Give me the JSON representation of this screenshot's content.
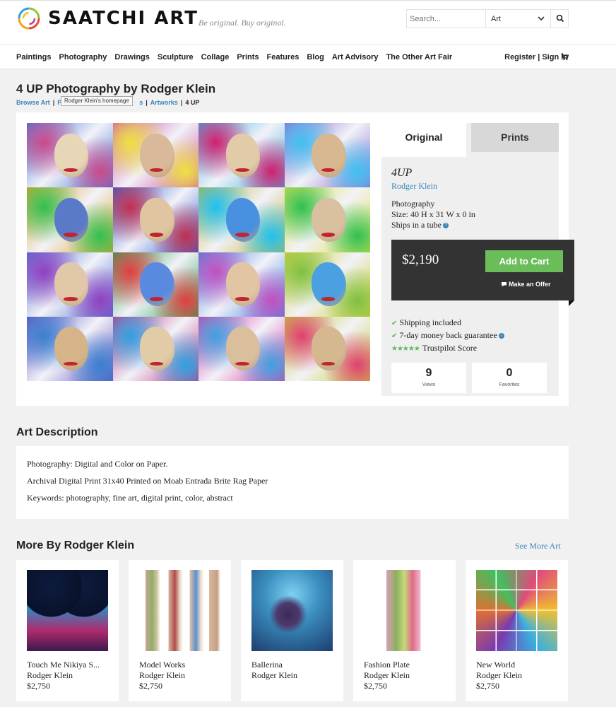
{
  "header": {
    "logo_text": "SAATCHI ART",
    "tagline": "Be original. Buy original.",
    "search_placeholder": "Search...",
    "search_category": "Art"
  },
  "nav": {
    "items": [
      "Paintings",
      "Photography",
      "Drawings",
      "Sculpture",
      "Collage",
      "Prints",
      "Features",
      "Blog",
      "Art Advisory",
      "The Other Art Fair"
    ],
    "account": "Register | Sign In"
  },
  "page": {
    "title": "4 UP Photography by Rodger Klein",
    "breadcrumb": [
      "Browse Art",
      "P",
      "s",
      "Artworks",
      "4 UP"
    ],
    "tooltip": "Rodger Klein's homepage"
  },
  "product": {
    "tab_original": "Original",
    "tab_prints": "Prints",
    "name": "4UP",
    "artist": "Rodger Klein",
    "medium": "Photography",
    "size": "Size: 40 H x 31 W x 0 in",
    "shipping": "Ships in a tube",
    "price": "$2,190",
    "add_to_cart": "Add to Cart",
    "make_offer": "Make an Offer",
    "benefits": [
      "Shipping included",
      "7-day money back guarantee",
      "Trustpilot Score"
    ],
    "views_count": "9",
    "views_label": "Views",
    "favorites_count": "0",
    "favorites_label": "Favorites"
  },
  "description": {
    "heading": "Art Description",
    "lines": [
      "Photography: Digital and Color on Paper.",
      "Archival Digital Print 31x40 Printed on Moab Entrada Brite Rag Paper",
      "Keywords: photography, fine art, digital print, color, abstract"
    ]
  },
  "more": {
    "heading": "More By Rodger Klein",
    "see_more": "See More Art",
    "items": [
      {
        "title": "Touch Me Nikiya S...",
        "artist": "Rodger Klein",
        "price": "$2,750"
      },
      {
        "title": "Model Works",
        "artist": "Rodger Klein",
        "price": "$2,750"
      },
      {
        "title": "Ballerina",
        "artist": "Rodger Klein",
        "price": ""
      },
      {
        "title": "Fashion Plate",
        "artist": "Rodger Klein",
        "price": "$2,750"
      },
      {
        "title": "New World",
        "artist": "Rodger Klein",
        "price": "$2,750"
      }
    ]
  },
  "colors": {
    "accent_blue": "#3a86b8",
    "cart_green": "#6bbd5a",
    "price_box": "#333333"
  },
  "icons": [
    "logo-mark-icon",
    "chevron-down-icon",
    "search-icon",
    "cart-icon",
    "question-icon",
    "comment-icon",
    "check-icon",
    "star-icon",
    "info-icon"
  ]
}
